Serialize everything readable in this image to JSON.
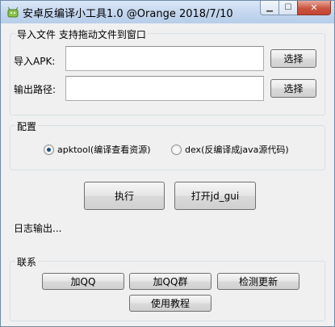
{
  "window": {
    "title": "安卓反编译小工具1.0 @Orange 2018/7/10",
    "minimize_icon": "minimize-icon",
    "maximize_icon": "maximize-icon",
    "close_icon": "close-icon"
  },
  "import_group": {
    "title": "导入文件 支持拖动文件到窗口",
    "apk_label": "导入APK:",
    "apk_value": "",
    "output_label": "输出路径:",
    "output_value": "",
    "browse_label": "选择"
  },
  "config_group": {
    "title": "配置",
    "options": [
      {
        "label": "apktool(编译查看资源)",
        "selected": true
      },
      {
        "label": "dex(反编译成java源代码)",
        "selected": false
      }
    ]
  },
  "actions": {
    "execute_label": "执行",
    "open_jdgui_label": "打开jd_gui"
  },
  "log": {
    "text": "日志输出..."
  },
  "contact_group": {
    "title": "联系",
    "buttons": [
      "加QQ",
      "加QQ群",
      "检测更新",
      "使用教程"
    ]
  },
  "colors": {
    "title_bar": "#c3d6ee",
    "close_button": "#c9553f",
    "window_bg": "#f0f0f0"
  }
}
